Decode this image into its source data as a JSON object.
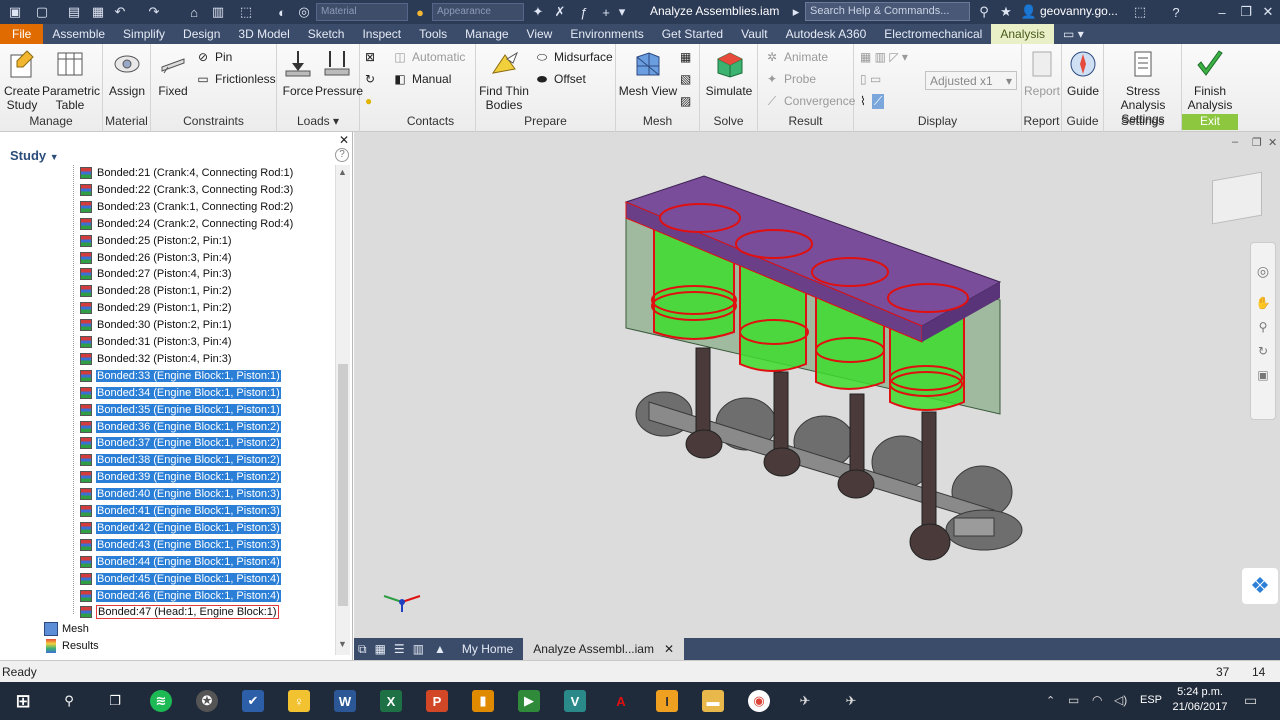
{
  "app": {
    "title": "Analyze Assemblies.iam",
    "search_placeholder": "Search Help & Commands...",
    "user": "geovanny.go...",
    "material_combo": "Material",
    "appearance_combo": "Appearance"
  },
  "tabs": [
    "File",
    "Assemble",
    "Simplify",
    "Design",
    "3D Model",
    "Sketch",
    "Inspect",
    "Tools",
    "Manage",
    "View",
    "Environments",
    "Get Started",
    "Vault",
    "Autodesk A360",
    "Electromechanical",
    "Analysis"
  ],
  "ribbon": {
    "manage": {
      "label": "Manage",
      "create_study": "Create\nStudy",
      "parametric_table": "Parametric\nTable"
    },
    "material": {
      "label": "Material",
      "assign": "Assign"
    },
    "constraints": {
      "label": "Constraints",
      "fixed": "Fixed",
      "pin": "Pin",
      "frictionless": "Frictionless"
    },
    "loads": {
      "label": "Loads",
      "force": "Force",
      "pressure": "Pressure"
    },
    "contacts": {
      "label": "Contacts",
      "automatic": "Automatic",
      "manual": "Manual"
    },
    "prepare": {
      "label": "Prepare",
      "find_thin_bodies": "Find Thin\nBodies",
      "midsurface": "Midsurface",
      "offset": "Offset"
    },
    "mesh": {
      "label": "Mesh",
      "mesh_view": "Mesh View"
    },
    "solve": {
      "label": "Solve",
      "simulate": "Simulate"
    },
    "result": {
      "label": "Result",
      "animate": "Animate",
      "probe": "Probe",
      "convergence": "Convergence"
    },
    "display": {
      "label": "Display",
      "adjusted": "Adjusted x1"
    },
    "report": {
      "label": "Report",
      "report": "Report"
    },
    "guide": {
      "label": "Guide",
      "guide": "Guide"
    },
    "settings": {
      "label": "Settings",
      "stress_analysis_settings": "Stress Analysis\nSettings"
    },
    "exit": {
      "label": "Exit",
      "finish_analysis": "Finish\nAnalysis"
    }
  },
  "browser": {
    "title": "Study",
    "items": [
      {
        "label": "Bonded:21 (Crank:4, Connecting Rod:1)",
        "selected": false
      },
      {
        "label": "Bonded:22 (Crank:3, Connecting Rod:3)",
        "selected": false
      },
      {
        "label": "Bonded:23 (Crank:1, Connecting Rod:2)",
        "selected": false
      },
      {
        "label": "Bonded:24 (Crank:2, Connecting Rod:4)",
        "selected": false
      },
      {
        "label": "Bonded:25 (Piston:2, Pin:1)",
        "selected": false
      },
      {
        "label": "Bonded:26 (Piston:3, Pin:4)",
        "selected": false
      },
      {
        "label": "Bonded:27 (Piston:4, Pin:3)",
        "selected": false
      },
      {
        "label": "Bonded:28 (Piston:1, Pin:2)",
        "selected": false
      },
      {
        "label": "Bonded:29 (Piston:1, Pin:2)",
        "selected": false
      },
      {
        "label": "Bonded:30 (Piston:2, Pin:1)",
        "selected": false
      },
      {
        "label": "Bonded:31 (Piston:3, Pin:4)",
        "selected": false
      },
      {
        "label": "Bonded:32 (Piston:4, Pin:3)",
        "selected": false
      },
      {
        "label": "Bonded:33 (Engine Block:1, Piston:1)",
        "selected": true
      },
      {
        "label": "Bonded:34 (Engine Block:1, Piston:1)",
        "selected": true
      },
      {
        "label": "Bonded:35 (Engine Block:1, Piston:1)",
        "selected": true
      },
      {
        "label": "Bonded:36 (Engine Block:1, Piston:2)",
        "selected": true
      },
      {
        "label": "Bonded:37 (Engine Block:1, Piston:2)",
        "selected": true
      },
      {
        "label": "Bonded:38 (Engine Block:1, Piston:2)",
        "selected": true
      },
      {
        "label": "Bonded:39 (Engine Block:1, Piston:2)",
        "selected": true
      },
      {
        "label": "Bonded:40 (Engine Block:1, Piston:3)",
        "selected": true
      },
      {
        "label": "Bonded:41 (Engine Block:1, Piston:3)",
        "selected": true
      },
      {
        "label": "Bonded:42 (Engine Block:1, Piston:3)",
        "selected": true
      },
      {
        "label": "Bonded:43 (Engine Block:1, Piston:3)",
        "selected": true
      },
      {
        "label": "Bonded:44 (Engine Block:1, Piston:4)",
        "selected": true
      },
      {
        "label": "Bonded:45 (Engine Block:1, Piston:4)",
        "selected": true
      },
      {
        "label": "Bonded:46 (Engine Block:1, Piston:4)",
        "selected": true
      },
      {
        "label": "Bonded:47 (Head:1, Engine Block:1)",
        "selected": false,
        "focused": true
      }
    ],
    "mesh": "Mesh",
    "results": "Results"
  },
  "doc_tabs": {
    "home": "My Home",
    "active": "Analyze Assembl...iam"
  },
  "status": {
    "text": "Ready",
    "count1": "37",
    "count2": "14"
  },
  "taskbar": {
    "lang": "ESP",
    "time": "5:24 p.m.",
    "date": "21/06/2017"
  },
  "colors": {
    "accent": "#e06b00",
    "selection": "#2b7fd6",
    "exit_green": "#8dc63f",
    "title_bar": "#2b3a55"
  }
}
